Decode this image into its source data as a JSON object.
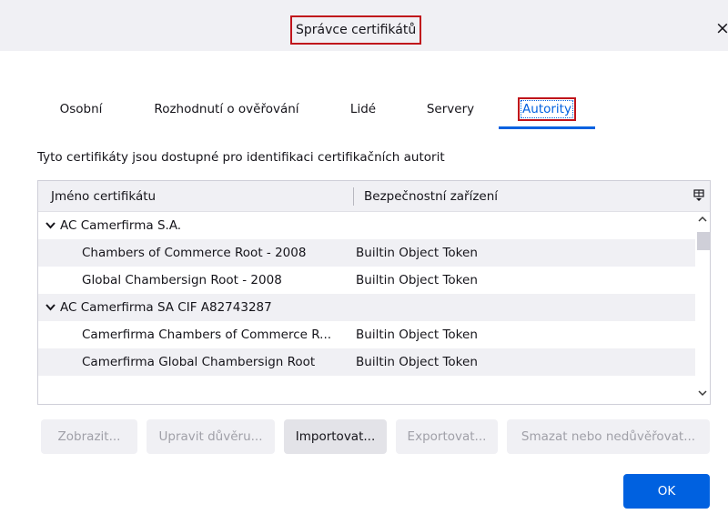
{
  "window": {
    "title": "Správce certifikátů",
    "close_glyph": "×"
  },
  "tabs": [
    {
      "label": "Osobní",
      "selected": false
    },
    {
      "label": "Rozhodnutí o ověřování",
      "selected": false
    },
    {
      "label": "Lidé",
      "selected": false
    },
    {
      "label": "Servery",
      "selected": false
    },
    {
      "label": "Autority",
      "selected": true
    }
  ],
  "description": "Tyto certifikáty jsou dostupné pro identifikaci certifikačních autorit",
  "table": {
    "columns": [
      "Jméno certifikátu",
      "Bezpečnostní zařízení"
    ],
    "rows": [
      {
        "type": "group",
        "name": "AC Camerfirma S.A.",
        "device": ""
      },
      {
        "type": "cert",
        "name": "Chambers of Commerce Root - 2008",
        "device": "Builtin Object Token"
      },
      {
        "type": "cert",
        "name": "Global Chambersign Root - 2008",
        "device": "Builtin Object Token"
      },
      {
        "type": "group",
        "name": "AC Camerfirma SA CIF A82743287",
        "device": ""
      },
      {
        "type": "cert",
        "name": "Camerfirma Chambers of Commerce R...",
        "device": "Builtin Object Token"
      },
      {
        "type": "cert",
        "name": "Camerfirma Global Chambersign Root",
        "device": "Builtin Object Token"
      }
    ]
  },
  "buttons": {
    "view": "Zobrazit...",
    "edit_trust": "Upravit důvěru...",
    "import": "Importovat...",
    "export": "Exportovat...",
    "delete": "Smazat nebo nedůvěřovat...",
    "ok": "OK"
  },
  "colors": {
    "accent": "#0061e0",
    "highlight_box": "#c0141b",
    "header_bg": "#f0f0f4"
  },
  "icons": {
    "close": "close-icon",
    "expand": "chevron-down-icon",
    "column_picker": "column-picker-icon",
    "scroll_up": "scroll-up-arrow-icon",
    "scroll_down": "scroll-down-arrow-icon"
  }
}
